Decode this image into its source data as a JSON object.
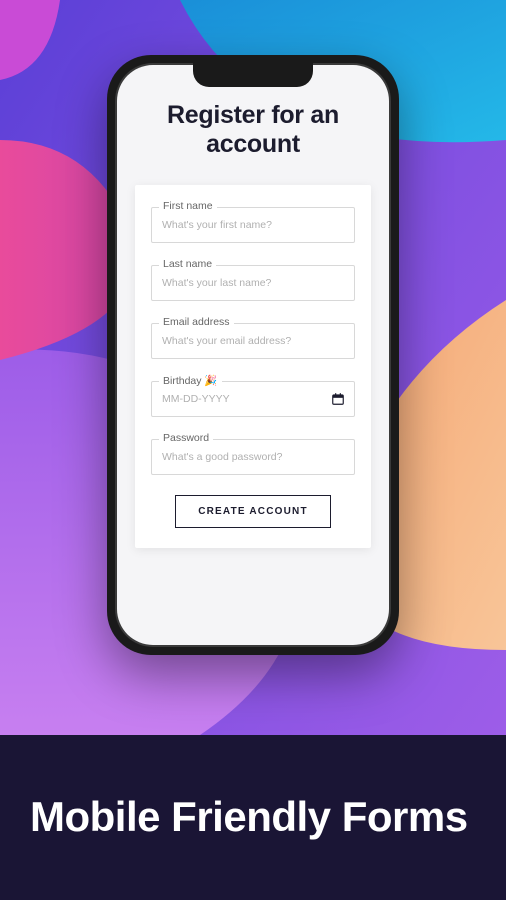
{
  "screen": {
    "title": "Register for an account"
  },
  "form": {
    "fields": {
      "first_name": {
        "label": "First name",
        "placeholder": "What's your first name?",
        "value": ""
      },
      "last_name": {
        "label": "Last name",
        "placeholder": "What's your last name?",
        "value": ""
      },
      "email": {
        "label": "Email address",
        "placeholder": "What's your email address?",
        "value": ""
      },
      "birthday": {
        "label": "Birthday 🎉",
        "placeholder": "MM-DD-YYYY",
        "value": ""
      },
      "password": {
        "label": "Password",
        "placeholder": "What's a good password?",
        "value": ""
      }
    },
    "submit_label": "CREATE ACCOUNT"
  },
  "caption": "Mobile Friendly Forms"
}
